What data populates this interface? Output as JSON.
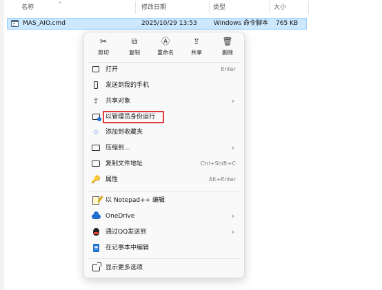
{
  "columns": {
    "name": "名称",
    "modified": "修改日期",
    "type": "类型",
    "size": "大小"
  },
  "file": {
    "name": "MAS_AIO.cmd",
    "modified": "2025/10/29 13:53",
    "type": "Windows 命令脚本",
    "size": "765 KB"
  },
  "quick_actions": [
    {
      "label": "剪切",
      "icon": "cut-icon",
      "glyph": "✂"
    },
    {
      "label": "复制",
      "icon": "copy-icon",
      "glyph": "⧉"
    },
    {
      "label": "重命名",
      "icon": "rename-icon",
      "glyph": "Ⓐ"
    },
    {
      "label": "共享",
      "icon": "share-icon",
      "glyph": "⇪"
    },
    {
      "label": "删除",
      "icon": "delete-icon",
      "glyph": "🗑"
    }
  ],
  "menu": {
    "open": {
      "label": "打开",
      "shortcut": "Enter"
    },
    "send_to_phone": {
      "label": "发送到我的手机"
    },
    "share_object": {
      "label": "共享对象",
      "arrow": "›"
    },
    "run_as_admin": {
      "label": "以管理员身份运行"
    },
    "add_to_favorites": {
      "label": "添加到收藏夹",
      "glyph": "☆"
    },
    "compress_to": {
      "label": "压缩到...",
      "arrow": "›"
    },
    "copy_path": {
      "label": "复制文件地址",
      "shortcut": "Ctrl+Shift+C"
    },
    "properties": {
      "label": "属性",
      "shortcut": "Alt+Enter",
      "glyph": "🔑"
    },
    "notepadpp": {
      "label": "以 Notepad++ 编辑"
    },
    "onedrive": {
      "label": "OneDrive",
      "arrow": "›"
    },
    "send_via_qq": {
      "label": "通过QQ发送到",
      "arrow": "›"
    },
    "edit_in_notepad": {
      "label": "在记事本中编辑"
    },
    "show_more": {
      "label": "显示更多选项"
    }
  },
  "colors": {
    "selection": "#cce8ff",
    "highlight_border": "#e03a3a",
    "accent": "#1f6fd1"
  }
}
